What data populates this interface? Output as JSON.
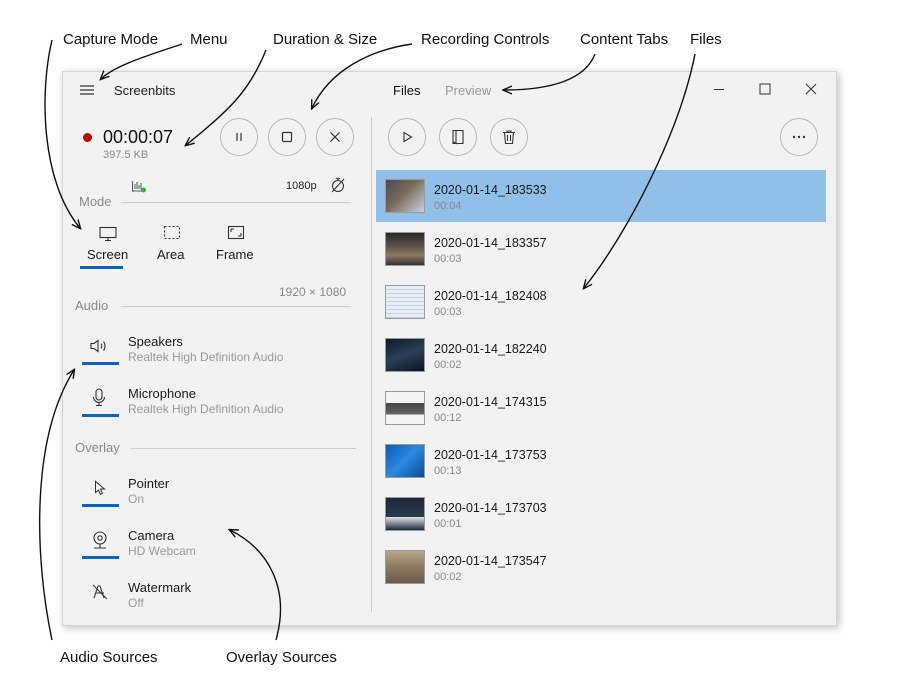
{
  "callouts": {
    "capture_mode": "Capture Mode",
    "menu": "Menu",
    "duration_size": "Duration & Size",
    "recording_controls": "Recording Controls",
    "content_tabs": "Content Tabs",
    "files": "Files",
    "audio_sources": "Audio Sources",
    "overlay_sources": "Overlay Sources"
  },
  "app": {
    "title": "Screenbits",
    "tabs": [
      "Files",
      "Preview"
    ],
    "active_tab": "Files"
  },
  "recording": {
    "duration": "00:00:07",
    "size": "397.5 KB",
    "status_color": "#c00000"
  },
  "controls": {
    "pause_icon": "pause-icon",
    "stop_icon": "stop-icon",
    "cancel_icon": "close-icon"
  },
  "settings": {
    "quality": "1080p",
    "mode_label": "Mode",
    "modes": [
      "Screen",
      "Area",
      "Frame"
    ],
    "active_mode": "Screen",
    "resolution": "1920 × 1080"
  },
  "audio": {
    "label": "Audio",
    "sources": [
      {
        "name": "Speakers",
        "device": "Realtek High Definition Audio",
        "active": true
      },
      {
        "name": "Microphone",
        "device": "Realtek High Definition Audio",
        "active": true
      }
    ]
  },
  "overlay": {
    "label": "Overlay",
    "sources": [
      {
        "name": "Pointer",
        "state": "On",
        "active": true
      },
      {
        "name": "Camera",
        "state": "HD Webcam",
        "active": true
      },
      {
        "name": "Watermark",
        "state": "Off",
        "active": false
      }
    ]
  },
  "files": [
    {
      "name": "2020-01-14_183533",
      "duration": "00:04",
      "selected": true
    },
    {
      "name": "2020-01-14_183357",
      "duration": "00:03",
      "selected": false
    },
    {
      "name": "2020-01-14_182408",
      "duration": "00:03",
      "selected": false
    },
    {
      "name": "2020-01-14_182240",
      "duration": "00:02",
      "selected": false
    },
    {
      "name": "2020-01-14_174315",
      "duration": "00:12",
      "selected": false
    },
    {
      "name": "2020-01-14_173753",
      "duration": "00:13",
      "selected": false
    },
    {
      "name": "2020-01-14_173703",
      "duration": "00:01",
      "selected": false
    },
    {
      "name": "2020-01-14_173547",
      "duration": "00:02",
      "selected": false
    }
  ],
  "colors": {
    "accent": "#0a64c8",
    "selection": "#90c0e8",
    "record": "#c00000"
  }
}
